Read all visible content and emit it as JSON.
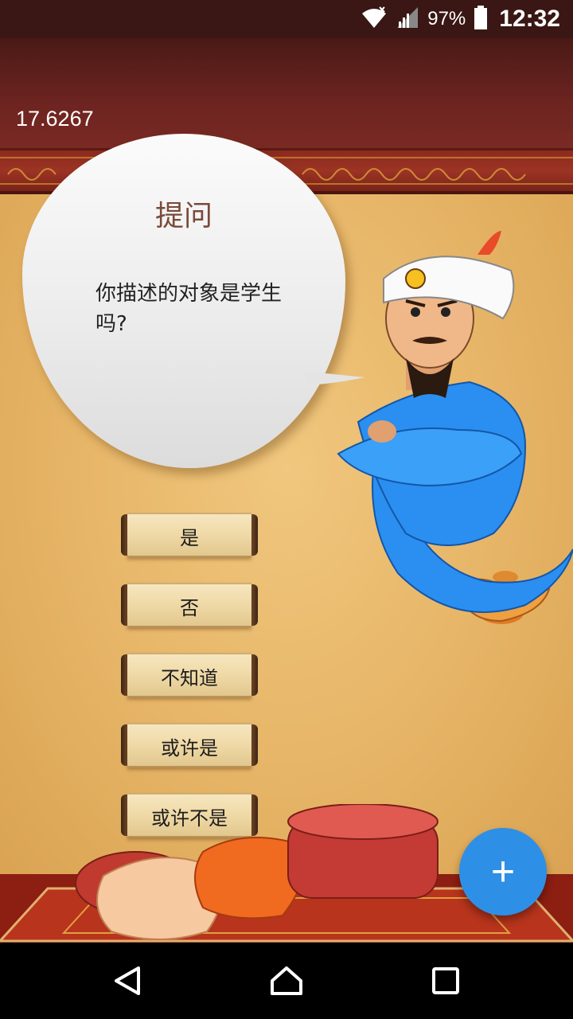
{
  "status_bar": {
    "battery_percent": "97%",
    "time": "12:32",
    "icons": [
      "wifi-icon",
      "signal-icon",
      "battery-icon"
    ]
  },
  "header": {
    "score": "17.6267"
  },
  "question": {
    "title": "提问",
    "text": "你描述的对象是学生吗?"
  },
  "answers": [
    {
      "label": "是"
    },
    {
      "label": "否"
    },
    {
      "label": "不知道"
    },
    {
      "label": "或许是"
    },
    {
      "label": "或许不是"
    }
  ],
  "fab": {
    "label": "+",
    "color": "#2e8fe6"
  },
  "nav": {
    "icons": [
      "back-icon",
      "home-icon",
      "recents-icon"
    ]
  },
  "colors": {
    "header": "#6e2420",
    "parchment": "#e6b466",
    "genie_blue": "#2a8ff0"
  }
}
